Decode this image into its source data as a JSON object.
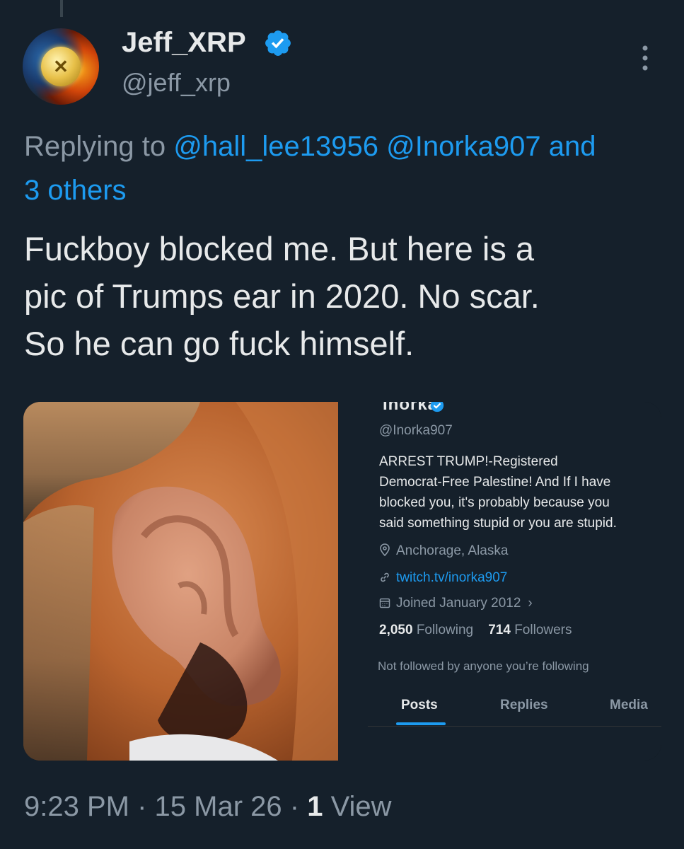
{
  "tweet": {
    "author_name": "Jeff_XRP",
    "author_handle": "@jeff_xrp",
    "replying_prefix": "Replying to",
    "replying_to": [
      "@hall_lee13956",
      "@Inorka907",
      "and"
    ],
    "replying_others": "3 others",
    "text_lines": [
      "Fuckboy blocked me. But here is a",
      "pic of Trumps ear in 2020. No scar.",
      "So he can go fuck himself."
    ],
    "time": "9:23 PM",
    "date": "15 Mar 26",
    "views_count": "1",
    "views_label": "View"
  },
  "embedded_profile": {
    "name": "Inorka",
    "handle": "@Inorka907",
    "bio_lines": [
      "ARREST TRUMP!-Registered",
      "Democrat-Free Palestine! And If I have",
      "blocked you, it's probably because you",
      "said something stupid or you are stupid."
    ],
    "location": "Anchorage, Alaska",
    "website": "twitch.tv/inorka907",
    "joined": "Joined January 2012",
    "following_count": "2,050",
    "following_label": "Following",
    "followers_count": "714",
    "followers_label": "Followers",
    "not_followed_note": "Not followed by anyone you’re following",
    "tabs": [
      "Posts",
      "Replies",
      "Media"
    ]
  },
  "colors": {
    "background": "#15202b",
    "link": "#1d9bf0",
    "secondary_text": "#8b98a5",
    "primary_text": "#e7e9ea"
  }
}
